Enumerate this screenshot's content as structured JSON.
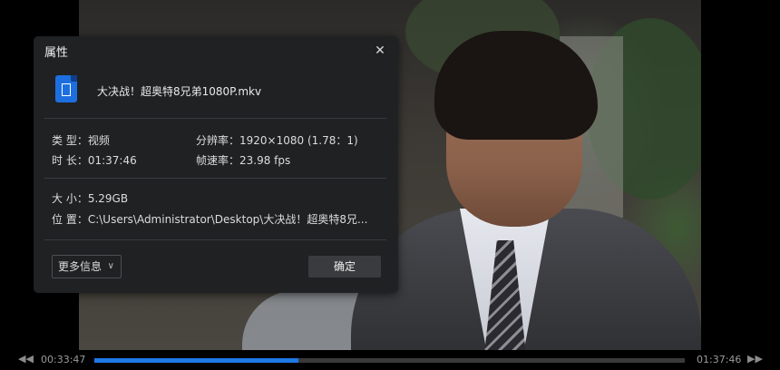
{
  "dialog": {
    "title": "属性",
    "file_name": "大决战！超奥特8兄弟1080P.mkv",
    "type_label": "类 型：",
    "type_value": "视频",
    "duration_label": "时 长：",
    "duration_value": "01:37:46",
    "resolution_label": "分辨率：",
    "resolution_value": "1920×1080 (1.78：1)",
    "framerate_label": "帧速率：",
    "framerate_value": "23.98 fps",
    "size_label": "大 小：",
    "size_value": "5.29GB",
    "location_label": "位 置：",
    "location_value": "C:\\Users\\Administrator\\Desktop\\大决战！超奥特8兄...",
    "more_info_label": "更多信息",
    "ok_label": "确定"
  },
  "player": {
    "current_time": "00:33:47",
    "total_time": "01:37:46",
    "progress_fraction": 0.345,
    "accent_color": "#1e78e6"
  },
  "icons": {
    "close": "close-icon",
    "file": "video-file-icon",
    "chevron": "chevron-down-icon",
    "rewind": "rewind-icon",
    "forward": "fast-forward-icon"
  }
}
